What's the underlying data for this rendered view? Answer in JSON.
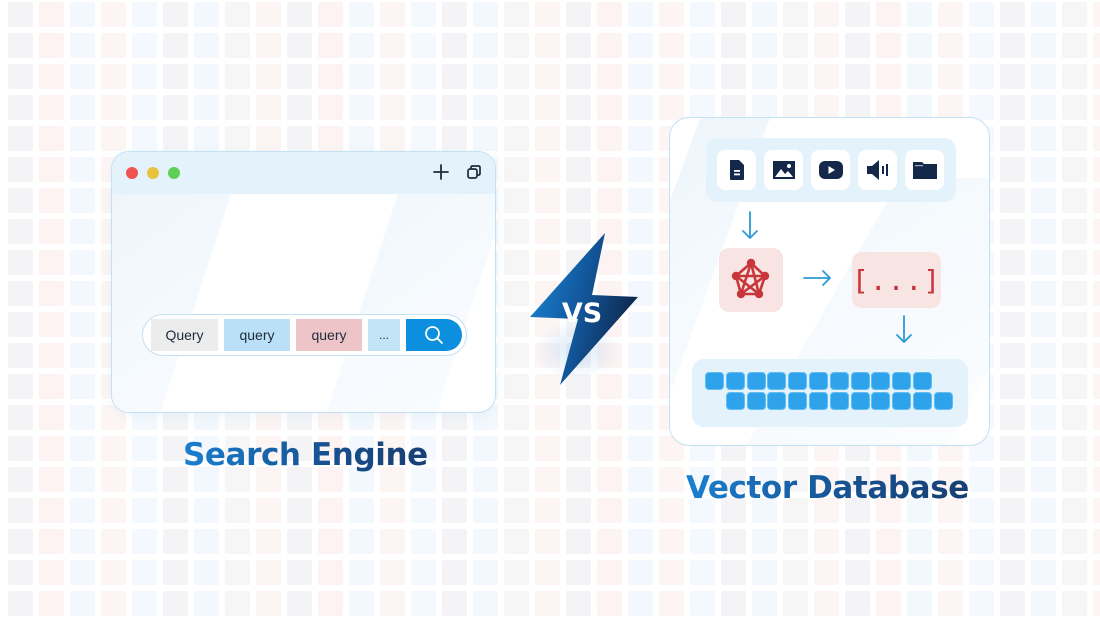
{
  "background": {
    "tile_colors": [
      "#f4f4f6",
      "#fdf3f2",
      "#f2f8fd",
      "#f6f6f7",
      "#fcf5f4",
      "#f3f9fe"
    ]
  },
  "search_engine": {
    "title": "Search Engine",
    "window_controls": {
      "dots": [
        "close",
        "minimize",
        "maximize"
      ],
      "dot_colors": [
        "#f15252",
        "#e8c33d",
        "#5fcf56"
      ],
      "icons": [
        "plus-icon",
        "copy-icon"
      ]
    },
    "search_bar": {
      "chips": [
        {
          "label": "Query",
          "color": "#ececec"
        },
        {
          "label": "query",
          "color": "#b9e0f7"
        },
        {
          "label": "query",
          "color": "#edc5c8"
        },
        {
          "label": "...",
          "color": "#c3e3f7"
        }
      ],
      "button_icon": "search-icon",
      "button_color": "#0d8fe0"
    }
  },
  "versus": {
    "label": "VS"
  },
  "vector_database": {
    "title": "Vector Database",
    "sources": [
      {
        "icon": "document-icon"
      },
      {
        "icon": "image-icon"
      },
      {
        "icon": "video-icon"
      },
      {
        "icon": "audio-icon"
      },
      {
        "icon": "folder-icon"
      }
    ],
    "embedding_model_icon": "neural-network-icon",
    "vector_label": "[...]",
    "storage_rows": [
      11,
      11
    ]
  },
  "colors": {
    "brand_blue": "#1a7fd0",
    "dark_navy": "#14284a",
    "accent_red": "#c8363c",
    "arrow_blue": "#2b9ad8",
    "cell_blue": "#2ea2ea"
  }
}
